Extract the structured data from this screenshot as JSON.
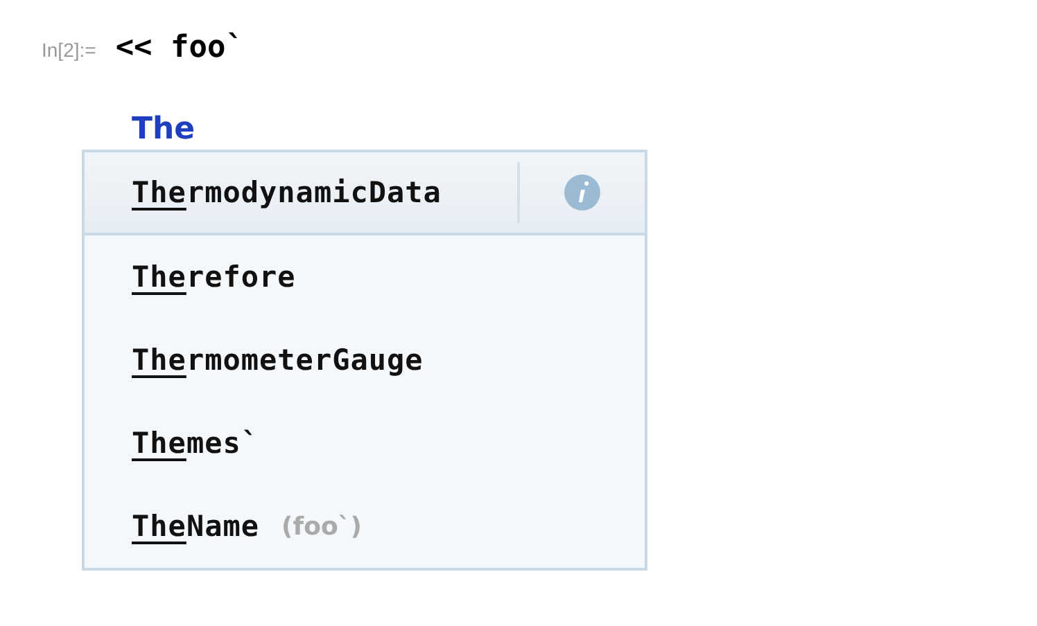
{
  "cell": {
    "label": "In[2]:=",
    "input": "<< foo`"
  },
  "typed": "The",
  "completions": [
    {
      "match": "The",
      "rest": "rmodynamicData",
      "selected": true,
      "info": true
    },
    {
      "match": "The",
      "rest": "refore",
      "selected": false
    },
    {
      "match": "The",
      "rest": "rmometerGauge",
      "selected": false
    },
    {
      "match": "The",
      "rest": "mes`",
      "selected": false
    },
    {
      "match": "The",
      "rest": "Name",
      "context": "(foo`)",
      "selected": false
    }
  ]
}
